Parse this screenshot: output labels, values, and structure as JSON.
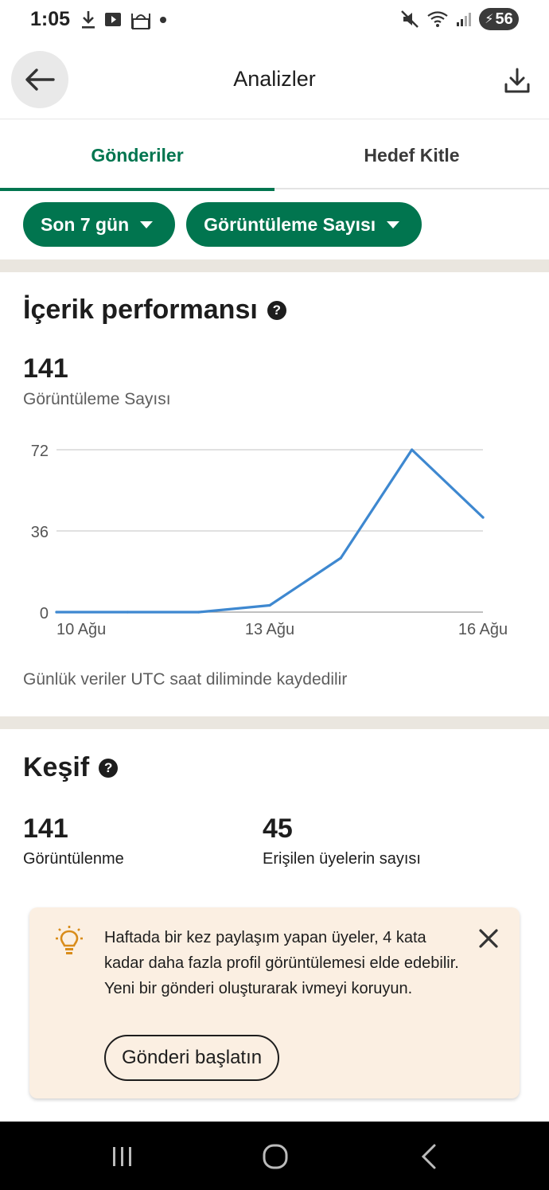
{
  "status_bar": {
    "time": "1:05",
    "battery": "56",
    "icons": [
      "download-icon",
      "youtube-icon",
      "mosque-icon",
      "dot-icon",
      "mute-icon",
      "wifi-icon",
      "signal-icon",
      "battery-charging-icon"
    ]
  },
  "app_bar": {
    "title": "Analizler",
    "back_icon": "arrow-left-icon",
    "download_icon": "download-icon"
  },
  "tabs": [
    {
      "label": "Gönderiler",
      "active": true
    },
    {
      "label": "Hedef Kitle",
      "active": false
    }
  ],
  "filters": [
    {
      "label": "Son 7 gün"
    },
    {
      "label": "Görüntüleme Sayısı"
    }
  ],
  "performance": {
    "title": "İçerik performansı",
    "help": "?",
    "total": "141",
    "metric_label": "Görüntüleme Sayısı",
    "note": "Günlük veriler UTC saat diliminde kaydedilir"
  },
  "chart_data": {
    "type": "line",
    "x": [
      "10 Ağu",
      "11 Ağu",
      "12 Ağu",
      "13 Ağu",
      "14 Ağu",
      "15 Ağu",
      "16 Ağu"
    ],
    "x_tick_labels": [
      "10 Ağu",
      "13 Ağu",
      "16 Ağu"
    ],
    "x_tick_index": [
      0,
      3,
      6
    ],
    "y_ticks": [
      72,
      36,
      0
    ],
    "series": [
      {
        "values": [
          0,
          0,
          0,
          3,
          24,
          72,
          42
        ],
        "color": "#3e88d0"
      }
    ],
    "ylim": [
      0,
      72
    ],
    "grid": true
  },
  "discovery": {
    "title": "Keşif",
    "help": "?",
    "views_value": "141",
    "views_label": "Görüntülenme",
    "reached_value": "45",
    "reached_label": "Erişilen üyelerin sayısı"
  },
  "tip": {
    "icon": "lightbulb-icon",
    "text": "Haftada bir kez paylaşım yapan üyeler, 4 kata kadar daha fazla profil görüntülemesi elde edebilir. Yeni bir gönderi oluşturarak ivmeyi koruyun.",
    "button_label": "Gönderi başlatın",
    "close_icon": "close-icon"
  },
  "nav_bar": {
    "items": [
      "recents-icon",
      "home-icon",
      "back-icon"
    ]
  }
}
